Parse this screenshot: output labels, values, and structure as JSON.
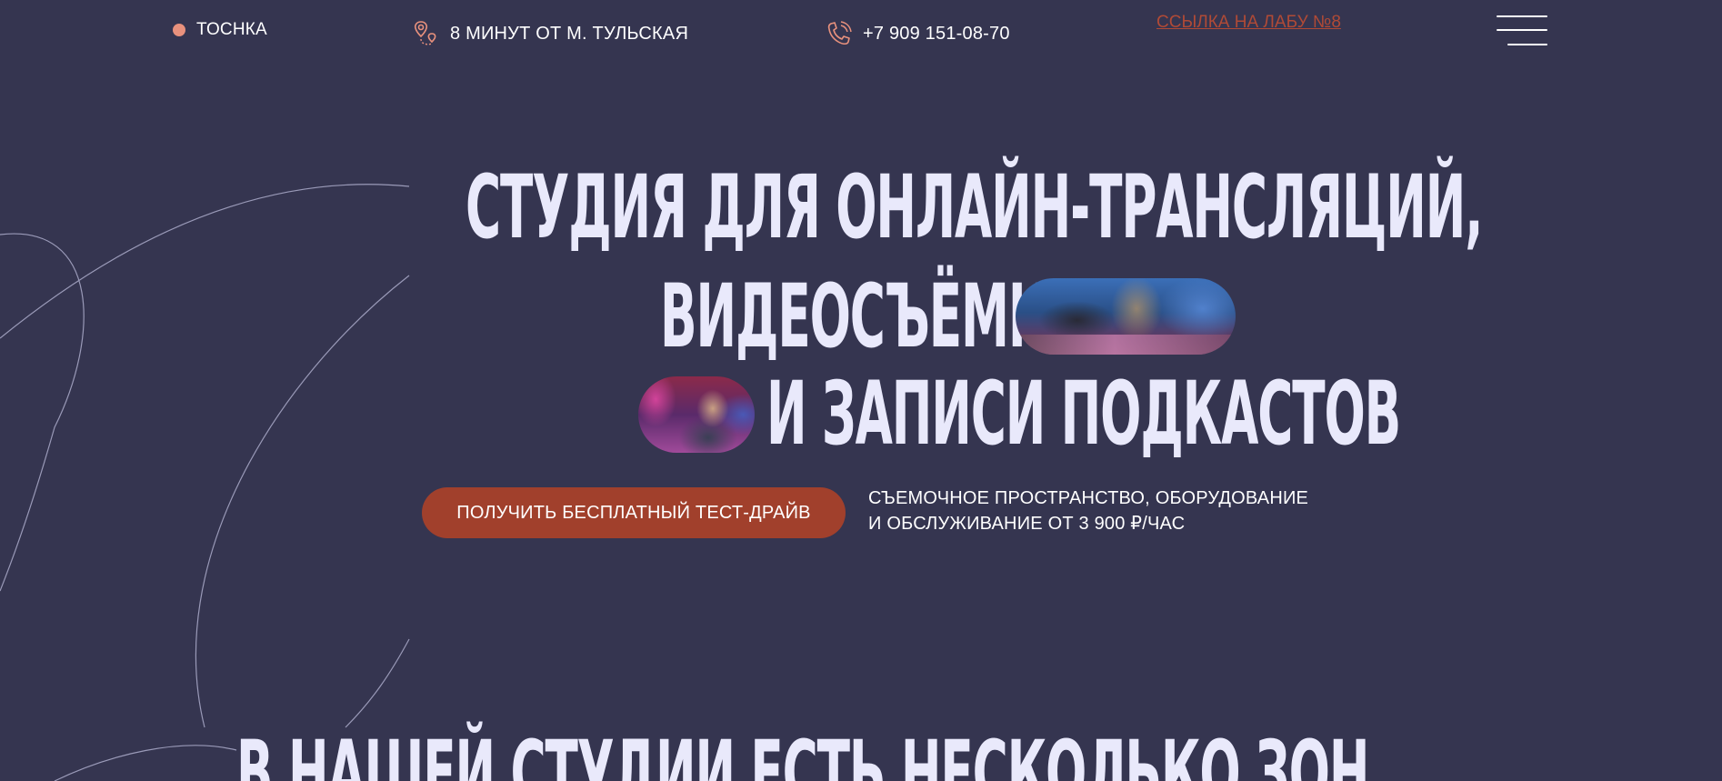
{
  "header": {
    "logo_text": "ТОСНКА",
    "address": "8 МИНУТ ОТ М. ТУЛЬСКАЯ",
    "phone": "+7 909 151-08-70",
    "lab_link": "ССЫЛКА НА ЛАБУ №8",
    "icons": [
      "map-pin-icon",
      "phone-icon",
      "menu-icon"
    ]
  },
  "hero": {
    "title_line1": "СТУДИЯ ДЛЯ ОНЛАЙН-ТРАНСЛЯЦИЙ,",
    "title_line2": "ВИДЕОСЪЁМКИ",
    "title_line3": "И ЗАПИСИ ПОДКАСТОВ",
    "cta_label": "ПОЛУЧИТЬ БЕСПЛАТНЫЙ ТЕСТ-ДРАЙВ",
    "desc_line1": "СЪЕМОЧНОЕ ПРОСТРАНСТВО, ОБОРУДОВАНИЕ",
    "desc_line2": "И ОБСЛУЖИВАНИЕ ОТ 3 900 ₽/ЧАС"
  },
  "zones": {
    "title": "В НАШЕЙ СТУДИИ ЕСТЬ НЕСКОЛЬКО ЗОН"
  },
  "colors": {
    "background": "#353550",
    "accent": "#a1402c",
    "accent_light": "#e8917d",
    "title": "#e9e9fb",
    "link": "#b04a36"
  }
}
